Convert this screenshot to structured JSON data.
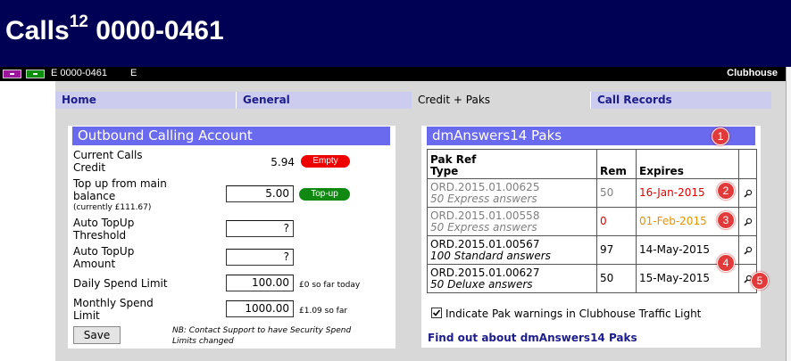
{
  "header": {
    "title_main": "Calls",
    "title_sup": "12",
    "title_number": "0000-0461"
  },
  "subbar": {
    "account_id": "E 0000-0461",
    "flag": "E",
    "clubhouse": "Clubhouse",
    "minimize_label": "-",
    "maximize_label": "-"
  },
  "tabs": [
    {
      "label": "Home"
    },
    {
      "label": "General"
    },
    {
      "label": "Credit + Paks"
    },
    {
      "label": "Call Records"
    }
  ],
  "outbound": {
    "title": "Outbound Calling Account",
    "current_credit_label_1": "Current Calls",
    "current_credit_label_2": "Credit",
    "current_credit_value": "5.94",
    "empty_badge": "Empty",
    "topup_label_1": "Top up from main",
    "topup_label_2": "balance",
    "topup_currently": "(currently £111.67)",
    "topup_value": "5.00",
    "topup_button": "Top-up",
    "auto_threshold_label_1": "Auto TopUp",
    "auto_threshold_label_2": "Threshold",
    "auto_threshold_value": "?",
    "auto_amount_label_1": "Auto TopUp",
    "auto_amount_label_2": "Amount",
    "auto_amount_value": "?",
    "daily_label": "Daily Spend Limit",
    "daily_value": "100.00",
    "daily_note": "£0 so far today",
    "monthly_label_1": "Monthly Spend",
    "monthly_label_2": "Limit",
    "monthly_value": "1000.00",
    "monthly_note": "£1.09 so far",
    "save_button": "Save",
    "security_note_1": "NB: Contact Support to have Security Spend",
    "security_note_2": "Limits changed"
  },
  "paks": {
    "title": "dmAnswers14 Paks",
    "columns": {
      "ref_1": "Pak Ref",
      "ref_2": "Type",
      "rem": "Rem",
      "expires": "Expires"
    },
    "rows": [
      {
        "ref": "ORD.2015.01.00625",
        "type": "50 Express answers",
        "rem": "50",
        "expires": "16-Jan-2015"
      },
      {
        "ref": "ORD.2015.01.00558",
        "type": "50 Express answers",
        "rem": "0",
        "expires": "01-Feb-2015"
      },
      {
        "ref": "ORD.2015.01.00567",
        "type": "100 Standard answers",
        "rem": "97",
        "expires": "14-May-2015"
      },
      {
        "ref": "ORD.2015.01.00627",
        "type": "50 Deluxe answers",
        "rem": "50",
        "expires": "15-May-2015"
      }
    ],
    "warning_checkbox_label": "Indicate Pak warnings in Clubhouse Traffic Light",
    "warning_checked": true,
    "find_out_link": "Find out about dmAnswers14 Paks"
  },
  "markers": [
    "1",
    "2",
    "3",
    "4",
    "5"
  ],
  "icons": {
    "row_action": "magnifier-icon",
    "checkbox": "checkmark-icon"
  },
  "colors": {
    "header_bg": "#000055",
    "panel_header": "#6a6aee",
    "tab_bar": "#ccccee",
    "empty_badge": "#ee0000",
    "topup_badge": "#118811",
    "expired": "#e00000",
    "expiring": "#e89400",
    "marker": "#e23a3a",
    "link": "#1c1c8c"
  }
}
